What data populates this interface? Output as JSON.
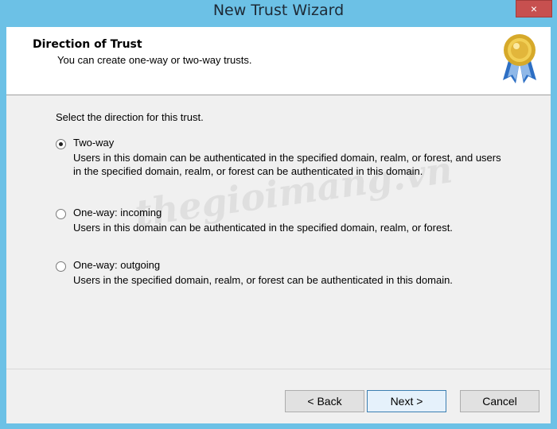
{
  "window": {
    "title": "New Trust Wizard",
    "close_label": "×"
  },
  "header": {
    "title": "Direction of Trust",
    "subtitle": "You can create one-way or two-way trusts.",
    "icon": "award-ribbon-icon"
  },
  "body": {
    "prompt": "Select the direction for this trust.",
    "options": [
      {
        "label": "Two-way",
        "description": "Users in this domain can be authenticated in the specified domain, realm, or forest, and users in the specified domain, realm, or forest can be authenticated in this domain.",
        "selected": true
      },
      {
        "label": "One-way: incoming",
        "description": "Users in this domain can be authenticated in the specified domain, realm, or forest.",
        "selected": false
      },
      {
        "label": "One-way: outgoing",
        "description": "Users in the specified domain, realm, or forest can be authenticated in this domain.",
        "selected": false
      }
    ]
  },
  "watermark": {
    "text": "thegioimang.vn"
  },
  "footer": {
    "back_label": "< Back",
    "next_label": "Next >",
    "cancel_label": "Cancel"
  },
  "colors": {
    "titlebar": "#6cc1e6",
    "close": "#c7504f",
    "client": "#f0f0f0"
  }
}
